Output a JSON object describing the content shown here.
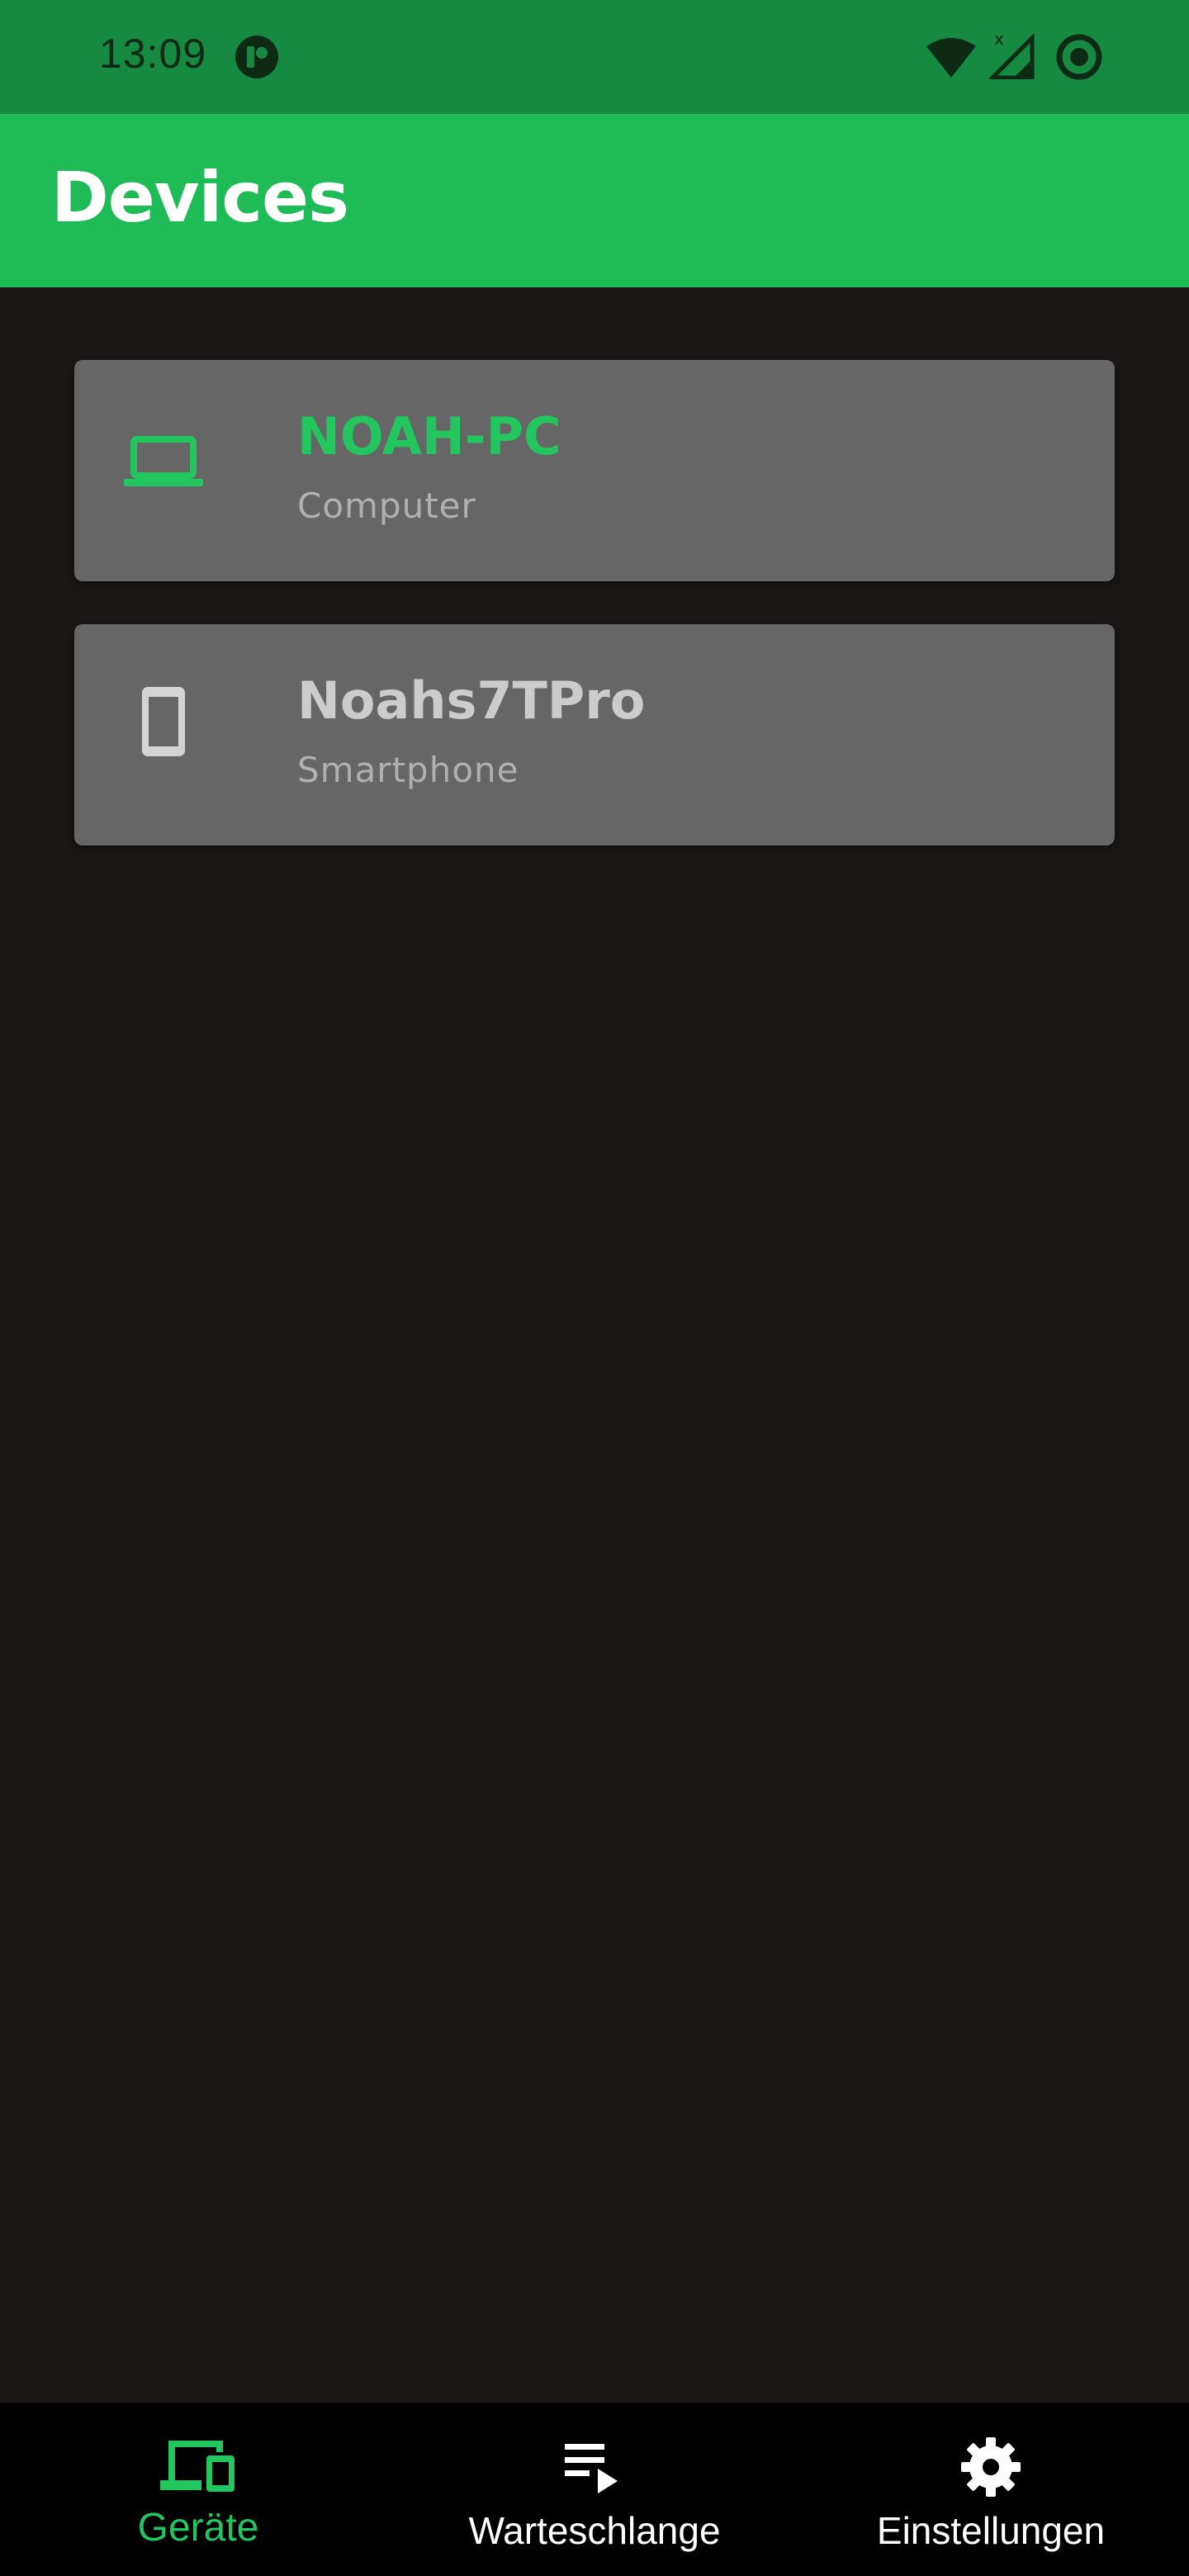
{
  "status_bar": {
    "time": "13:09",
    "icons": [
      "app-notification-icon",
      "wifi-icon",
      "signal-icon",
      "data-saver-icon"
    ]
  },
  "app_bar": {
    "title": "Devices"
  },
  "devices": [
    {
      "name": "NOAH-PC",
      "type": "Computer",
      "icon": "laptop-icon",
      "active": true
    },
    {
      "name": "Noahs7TPro",
      "type": "Smartphone",
      "icon": "smartphone-icon",
      "active": false
    }
  ],
  "bottom_nav": {
    "items": [
      {
        "label": "Geräte",
        "icon": "devices-icon",
        "active": true
      },
      {
        "label": "Warteschlange",
        "icon": "queue-icon",
        "active": false
      },
      {
        "label": "Einstellungen",
        "icon": "settings-icon",
        "active": false
      }
    ]
  },
  "colors": {
    "status_bar": "#178a42",
    "app_bar": "#1fbb56",
    "accent": "#22c55e",
    "background": "#1a1616",
    "card": "#666666",
    "nav_background": "#000000"
  }
}
